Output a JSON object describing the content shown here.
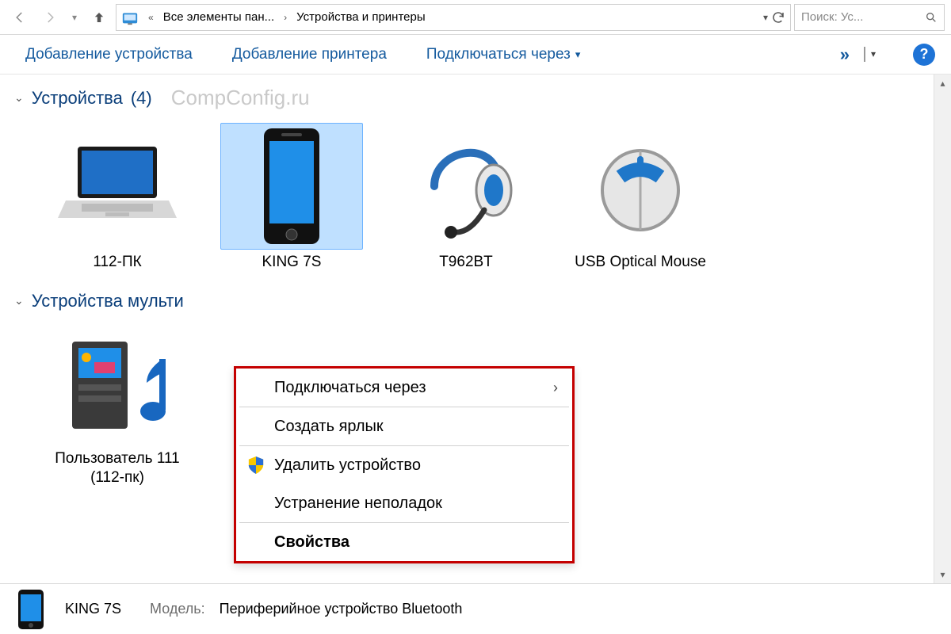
{
  "nav": {
    "crumb1_icon": "control-panel-icon",
    "crumb1": "Все элементы пан...",
    "crumb2": "Устройства и принтеры"
  },
  "search": {
    "placeholder": "Поиск: Ус..."
  },
  "toolbar": {
    "add_device": "Добавление устройства",
    "add_printer": "Добавление принтера",
    "connect_via": "Подключаться через"
  },
  "groups": {
    "devices": {
      "title": "Устройства",
      "count": "(4)"
    },
    "multimedia": {
      "title": "Устройства мульти"
    }
  },
  "watermark": "CompConfig.ru",
  "devices": [
    {
      "name": "112-ПК",
      "kind": "laptop"
    },
    {
      "name": "KING 7S",
      "kind": "phone",
      "selected": true
    },
    {
      "name": "T962BT",
      "kind": "headset"
    },
    {
      "name": "USB Optical Mouse",
      "kind": "mouse"
    }
  ],
  "multimedia": [
    {
      "name": "Пользователь 111 (112-пк)",
      "kind": "media-pc"
    }
  ],
  "context_menu": {
    "connect_via": "Подключаться через",
    "create_shortcut": "Создать ярлык",
    "remove_device": "Удалить устройство",
    "troubleshoot": "Устранение неполадок",
    "properties": "Свойства"
  },
  "details": {
    "name": "KING 7S",
    "model_key": "Модель:",
    "model_val": "Периферийное устройство Bluetooth"
  }
}
